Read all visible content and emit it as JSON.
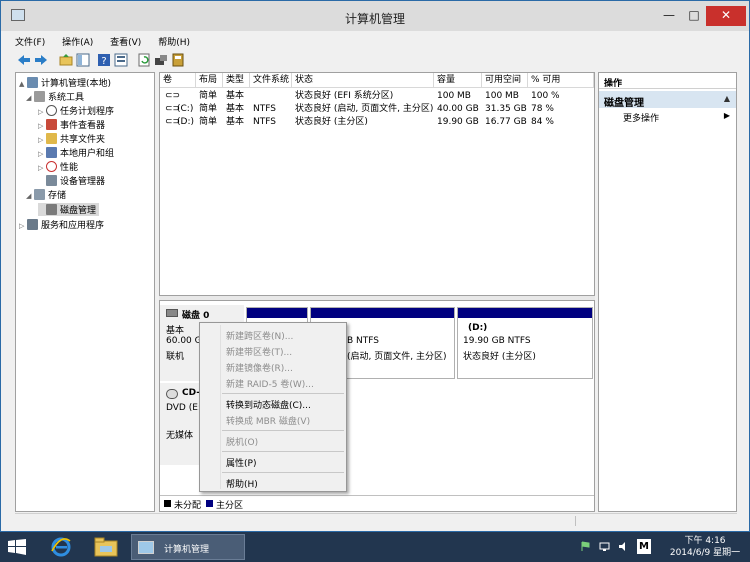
{
  "window": {
    "title": "计算机管理",
    "min_glyph": "—",
    "max_glyph": "□",
    "close_glyph": "✕"
  },
  "menu": [
    "文件(F)",
    "操作(A)",
    "查看(V)",
    "帮助(H)"
  ],
  "toolbar_icons": [
    "back-arrow-icon",
    "forward-arrow-icon",
    "up-folder-icon",
    "show-hide-tree-icon",
    "help-icon",
    "properties-icon",
    "refresh-icon",
    "export-icon",
    "disk-icon"
  ],
  "tree": [
    {
      "label": "计算机管理(本地)",
      "level": 0,
      "expander": "▲",
      "icon": "computer-icon"
    },
    {
      "label": "系统工具",
      "level": 1,
      "expander": "◢",
      "icon": "tools-icon"
    },
    {
      "label": "任务计划程序",
      "level": 2,
      "expander": "▷",
      "icon": "clock-icon"
    },
    {
      "label": "事件查看器",
      "level": 2,
      "expander": "▷",
      "icon": "event-viewer-icon"
    },
    {
      "label": "共享文件夹",
      "level": 2,
      "expander": "▷",
      "icon": "shared-folder-icon"
    },
    {
      "label": "本地用户和组",
      "level": 2,
      "expander": "▷",
      "icon": "users-icon"
    },
    {
      "label": "性能",
      "level": 2,
      "expander": "▷",
      "icon": "performance-icon"
    },
    {
      "label": "设备管理器",
      "level": 2,
      "expander": "",
      "icon": "device-manager-icon"
    },
    {
      "label": "存储",
      "level": 1,
      "expander": "◢",
      "icon": "storage-icon"
    },
    {
      "label": "磁盘管理",
      "level": 2,
      "expander": "",
      "icon": "disk-management-icon"
    },
    {
      "label": "服务和应用程序",
      "level": 1,
      "expander": "▷",
      "icon": "services-icon"
    }
  ],
  "volume_table": {
    "headers": [
      "卷",
      "布局",
      "类型",
      "文件系统",
      "状态",
      "容量",
      "可用空间",
      "% 可用"
    ],
    "rows": [
      [
        "",
        "简单",
        "基本",
        "",
        "状态良好 (EFI 系统分区)",
        "100 MB",
        "100 MB",
        "100 %"
      ],
      [
        "(C:)",
        "简单",
        "基本",
        "NTFS",
        "状态良好 (启动, 页面文件, 主分区)",
        "40.00 GB",
        "31.35 GB",
        "78 %"
      ],
      [
        "(D:)",
        "简单",
        "基本",
        "NTFS",
        "状态良好 (主分区)",
        "19.90 GB",
        "16.77 GB",
        "84 %"
      ]
    ]
  },
  "disk0": {
    "name": "磁盘 0",
    "type": "基本",
    "size": "60.00 G",
    "status": "联机",
    "c_fragment": "B NTFS",
    "c_fragment_status": "(启动, 页面文件, 主分区)",
    "d_label": "(D:)",
    "d_size": "19.90 GB NTFS",
    "d_status": "状态良好 (主分区)"
  },
  "cdrom": {
    "name": "CD-",
    "type": "DVD (E:",
    "status": "无媒体"
  },
  "legend": [
    {
      "label": "未分配",
      "color": "#000000"
    },
    {
      "label": "主分区",
      "color": "#000080"
    }
  ],
  "actions": {
    "header": "操作",
    "section": "磁盘管理",
    "more": "更多操作"
  },
  "context_menu": [
    {
      "label": "新建跨区卷(N)...",
      "enabled": false
    },
    {
      "label": "新建带区卷(T)...",
      "enabled": false
    },
    {
      "label": "新建镜像卷(R)...",
      "enabled": false
    },
    {
      "label": "新建 RAID-5 卷(W)...",
      "enabled": false
    },
    {
      "label": "转换到动态磁盘(C)...",
      "enabled": true
    },
    {
      "label": "转换成 MBR 磁盘(V)",
      "enabled": false
    },
    {
      "label": "脱机(O)",
      "enabled": false
    },
    {
      "label": "属性(P)",
      "enabled": true
    },
    {
      "label": "帮助(H)",
      "enabled": true
    }
  ],
  "taskbar": {
    "app_label": "计算机管理",
    "time": "下午 4:16",
    "date": "2014/6/9 星期一",
    "ime": "M"
  },
  "colors": {
    "primary_partition": "#000080",
    "unallocated": "#000000",
    "accent": "#2a6aa7"
  }
}
